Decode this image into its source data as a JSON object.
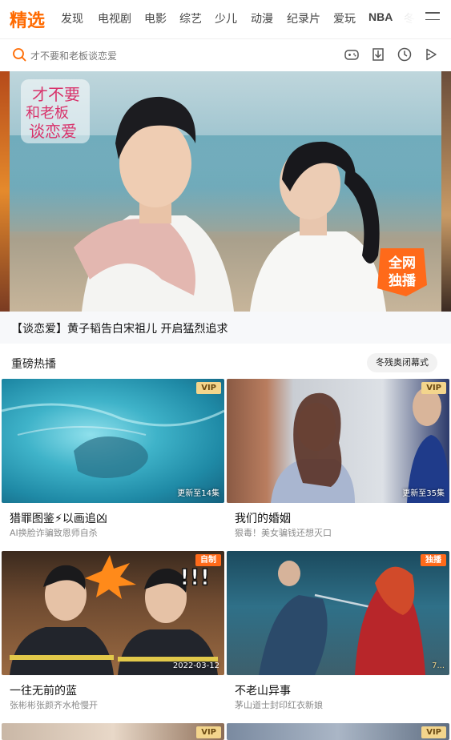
{
  "nav": {
    "active_tab": "精选",
    "tabs": [
      "发现",
      "电视剧",
      "电影",
      "综艺",
      "少儿",
      "动漫",
      "纪录片",
      "爱玩",
      "NBA",
      "冬"
    ]
  },
  "search": {
    "placeholder": "才不要和老板谈恋爱",
    "icons": [
      "search-icon",
      "gamepad-icon",
      "download-icon",
      "history-icon",
      "play-icon"
    ]
  },
  "banner": {
    "logo_text": [
      "才不要",
      "和老板",
      "谈恋爱"
    ],
    "badge_lines": [
      "全网",
      "独播"
    ],
    "caption": "【谈恋爱】黄子韬告白宋祖儿 开启猛烈追求"
  },
  "section": {
    "title": "重磅热播",
    "pill": "冬残奥闭幕式"
  },
  "cards": [
    {
      "title": "猎罪图鉴⚡以画追凶",
      "subtitle": "AI换脸诈骗致恩师自杀",
      "badge": "VIP",
      "corner": "更新至14集"
    },
    {
      "title": "我们的婚姻",
      "subtitle": "狠毒！美女骗钱还想灭口",
      "badge": "VIP",
      "corner": "更新至35集"
    },
    {
      "title": "一往无前的蓝",
      "subtitle": "张彬彬张颜齐水枪慢开",
      "badge": "自制",
      "corner": "2022-03-12"
    },
    {
      "title": "不老山异事",
      "subtitle": "茅山道士封印红衣新娘",
      "badge": "独播",
      "corner": "7..."
    }
  ],
  "bottom_badges": [
    "VIP",
    "VIP"
  ],
  "colors": {
    "accent": "#ff6a00",
    "vip_gold": "#f3d58c",
    "badge_orange": "#ff6a1a"
  }
}
